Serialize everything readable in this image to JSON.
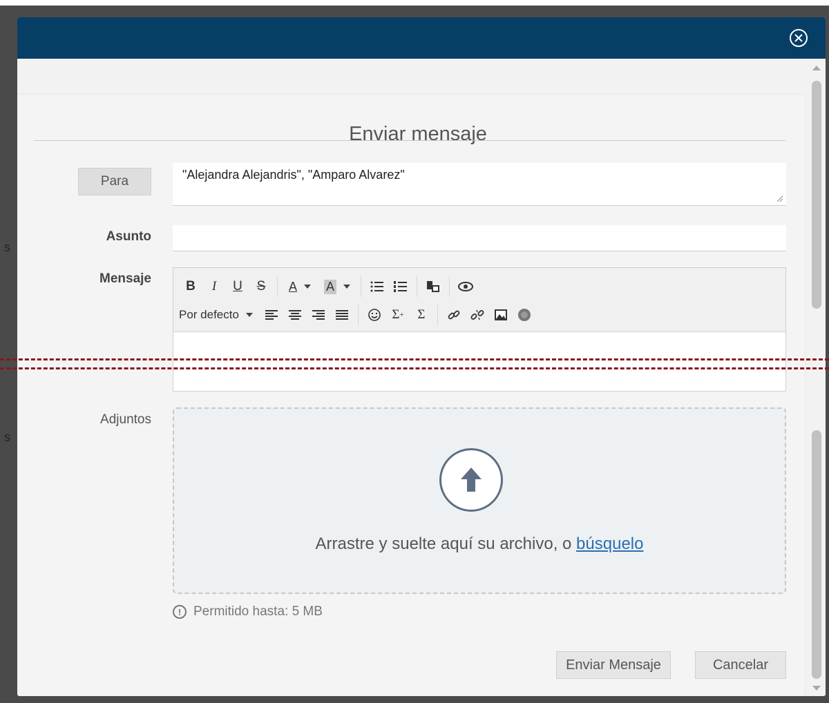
{
  "dialog": {
    "title": "Enviar mensaje",
    "close_icon": "close-circle-icon",
    "header_color": "#063e65"
  },
  "form": {
    "to_button_label": "Para",
    "to_value": "\"Alejandra Alejandris\", \"Amparo Alvarez\"",
    "subject_label": "Asunto",
    "subject_value": "",
    "message_label": "Mensaje",
    "attachments_label": "Adjuntos"
  },
  "editor": {
    "toolbar_row1": [
      {
        "name": "bold-icon",
        "glyph": "B"
      },
      {
        "name": "italic-icon",
        "glyph": "I"
      },
      {
        "name": "underline-icon",
        "glyph": "U"
      },
      {
        "name": "strikethrough-icon",
        "glyph": "S"
      },
      {
        "name": "text-color-icon",
        "glyph": "A"
      },
      {
        "name": "background-color-icon",
        "glyph": "A"
      },
      {
        "name": "bulleted-list-icon",
        "glyph": "☰"
      },
      {
        "name": "numbered-list-icon",
        "glyph": "☷"
      },
      {
        "name": "paste-icon",
        "glyph": "📋"
      },
      {
        "name": "preview-eye-icon",
        "glyph": "👁"
      }
    ],
    "font_default": "Por defecto",
    "toolbar_row2": [
      {
        "name": "align-left-icon"
      },
      {
        "name": "align-center-icon"
      },
      {
        "name": "align-right-icon"
      },
      {
        "name": "align-justify-icon"
      },
      {
        "name": "emoji-icon",
        "glyph": "☺"
      },
      {
        "name": "formula-icon",
        "glyph": "Σ"
      },
      {
        "name": "sum-icon",
        "glyph": "Σ"
      },
      {
        "name": "link-icon",
        "glyph": "🔗"
      },
      {
        "name": "unlink-icon"
      },
      {
        "name": "image-icon"
      },
      {
        "name": "special-icon"
      }
    ]
  },
  "attachments": {
    "upload_icon": "upload-arrow-icon",
    "drop_text": "Arrastre y suelte aquí su archivo, o ",
    "drop_link": "búsquelo",
    "limit_text": "Permitido hasta: 5 MB"
  },
  "actions": {
    "send_label": "Enviar Mensaje",
    "cancel_label": "Cancelar"
  }
}
